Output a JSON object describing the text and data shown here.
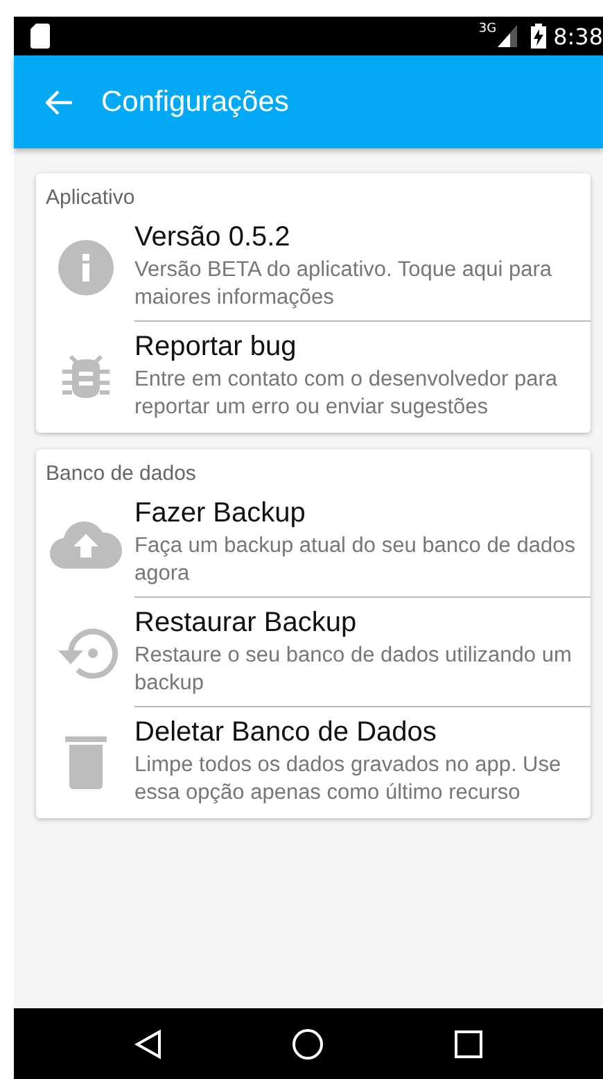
{
  "status_bar": {
    "network": "3G",
    "time": "8:38"
  },
  "app_bar": {
    "title": "Configurações"
  },
  "sections": [
    {
      "header": "Aplicativo",
      "items": [
        {
          "kind": "info",
          "title": "Versão 0.5.2",
          "subtitle": "Versão BETA do aplicativo. Toque aqui para maiores informações"
        },
        {
          "kind": "bug",
          "title": "Reportar bug",
          "subtitle": "Entre em contato com o desenvolvedor para reportar um erro ou enviar sugestões"
        }
      ]
    },
    {
      "header": "Banco de dados",
      "items": [
        {
          "kind": "upload",
          "title": "Fazer Backup",
          "subtitle": "Faça um backup atual do seu banco de dados agora"
        },
        {
          "kind": "restore",
          "title": "Restaurar Backup",
          "subtitle": "Restaure o seu banco de dados utilizando um backup"
        },
        {
          "kind": "delete",
          "title": "Deletar Banco de Dados",
          "subtitle": "Limpe todos os dados gravados no app. Use essa opção apenas como último recurso"
        }
      ]
    }
  ]
}
